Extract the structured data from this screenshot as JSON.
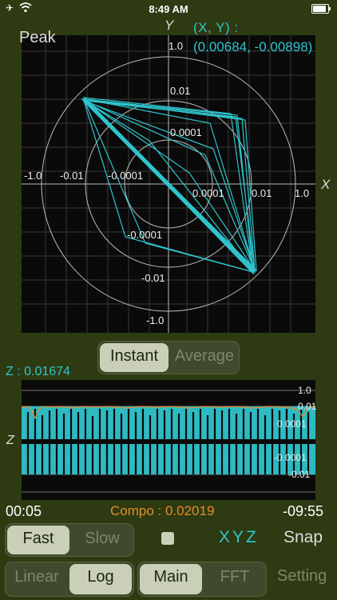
{
  "status_bar": {
    "time": "8:49 AM"
  },
  "polar_plot": {
    "peak_label": "Peak",
    "y_axis_label": "Y",
    "x_axis_label": "X",
    "xy_label": "(X, Y)  :",
    "xy_value": "(0.00684, -0.00898)",
    "y_ticks": [
      "1.0",
      "0.01",
      "0.0001",
      "-0.0001",
      "-0.01",
      "-1.0"
    ],
    "x_ticks": [
      "-1.0",
      "-0.01",
      "-0.0001",
      "0.0001",
      "0.01",
      "1.0"
    ],
    "trace_color": "#2fc4cc",
    "grid_color": "#3a3a3a"
  },
  "mode_toggle": {
    "instant": "Instant",
    "average": "Average",
    "selected": "Instant"
  },
  "z_plot": {
    "z_value_label": "Z : 0.01674",
    "axis_label": "Z",
    "ticks": [
      "1.0",
      "0.01",
      "0.0001",
      "-0.0001",
      "-0.01"
    ],
    "trace_color": "#2fc4cc",
    "compo_color": "#e58a2a"
  },
  "timeline": {
    "elapsed": "00:05",
    "remaining": "-09:55",
    "compo": "Compo : 0.02019"
  },
  "speed_toggle": {
    "fast": "Fast",
    "slow": "Slow",
    "selected": "Fast"
  },
  "xyz_label": "XYZ",
  "snap_label": "Snap",
  "scale_toggle": {
    "linear": "Linear",
    "log": "Log",
    "selected": "Log"
  },
  "view_toggle": {
    "main": "Main",
    "fft": "FFT",
    "selected": "Main"
  },
  "setting_label": "Setting"
}
